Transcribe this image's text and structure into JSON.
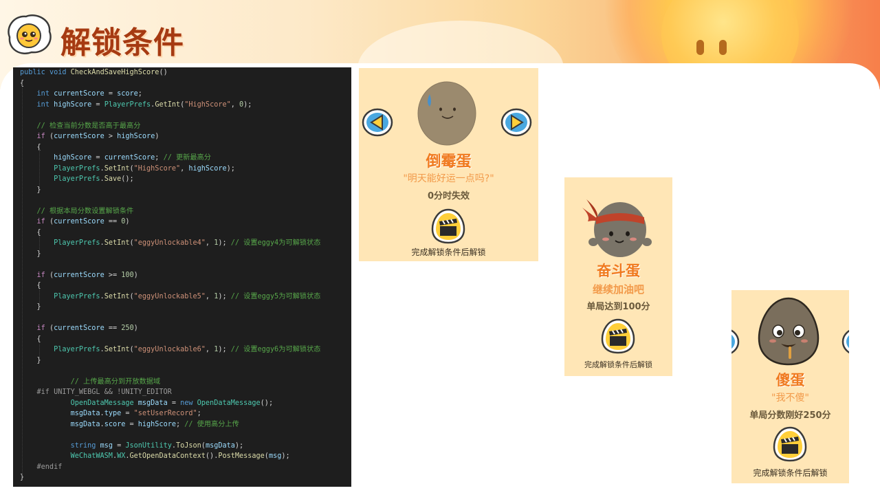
{
  "header": {
    "title": "解锁条件",
    "logo_icon": "egg-mascot-icon"
  },
  "colors": {
    "title": "#a63a12",
    "card_bg": "#ffe6b6",
    "card_name": "#f07a1f",
    "code_bg": "#1e1e1e"
  },
  "code": {
    "lines": [
      "public void CheckAndSaveHighScore()",
      "{",
      "    int currentScore = score;",
      "    int highScore = PlayerPrefs.GetInt(\"HighScore\", 0);",
      "",
      "    // 检查当前分数是否高于最高分",
      "    if (currentScore > highScore)",
      "    {",
      "        highScore = currentScore; // 更新最高分",
      "        PlayerPrefs.SetInt(\"HighScore\", highScore);",
      "        PlayerPrefs.Save();",
      "    }",
      "",
      "    // 根据本局分数设置解锁条件",
      "    if (currentScore == 0)",
      "    {",
      "        PlayerPrefs.SetInt(\"eggyUnlockable4\", 1); // 设置eggy4为可解锁状态",
      "    }",
      "",
      "    if (currentScore >= 100)",
      "    {",
      "        PlayerPrefs.SetInt(\"eggyUnlockable5\", 1); // 设置eggy5为可解锁状态",
      "    }",
      "",
      "    if (currentScore == 250)",
      "    {",
      "        PlayerPrefs.SetInt(\"eggyUnlockable6\", 1); // 设置eggy6为可解锁状态",
      "    }",
      "",
      "            // 上传最高分到开放数据域",
      "    #if UNITY_WEBGL && !UNITY_EDITOR",
      "            OpenDataMessage msgData = new OpenDataMessage();",
      "            msgData.type = \"setUserRecord\";",
      "            msgData.score = highScore; // 使用高分上传",
      "",
      "            string msg = JsonUtility.ToJson(msgData);",
      "            WeChatWASM.WX.GetOpenDataContext().PostMessage(msg);",
      "    #endif",
      "}"
    ]
  },
  "cards": [
    {
      "name": "倒霉蛋",
      "quote": "\"明天能好运一点吗?\"",
      "requirement": "0分时失效",
      "footer": "完成解锁条件后解锁",
      "avatar_icon": "unlucky-egg-icon"
    },
    {
      "name": "奋斗蛋",
      "quote": "继续加油吧",
      "requirement": "单局达到100分",
      "footer": "完成解锁条件后解锁",
      "avatar_icon": "fighter-egg-icon"
    },
    {
      "name": "傻蛋",
      "quote": "\"我不傻\"",
      "requirement": "单局分数刚好250分",
      "footer": "完成解锁条件后解锁",
      "avatar_icon": "silly-egg-icon"
    }
  ]
}
